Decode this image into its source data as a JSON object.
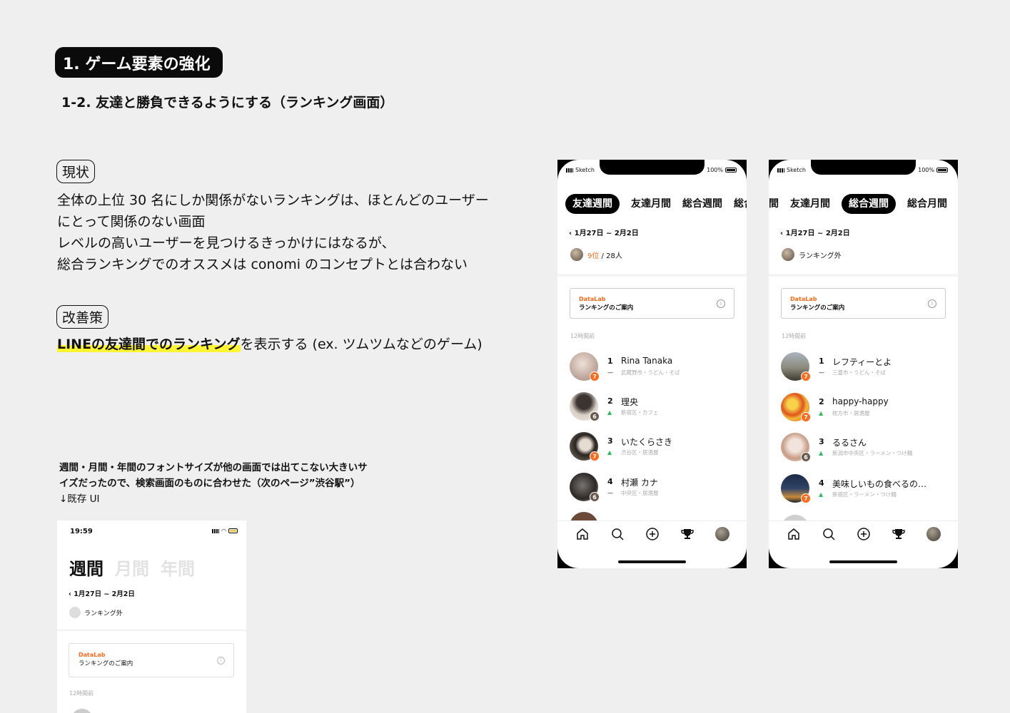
{
  "section": {
    "title": "1. ゲーム要素の強化",
    "subtitle": "1-2. 友達と勝負できるようにする（ランキング画面）"
  },
  "current": {
    "tag": "現状",
    "lines": [
      "全体の上位 30 名にしか関係がないランキングは、ほとんどのユーザー",
      "にとって関係のない画面",
      "レベルの高いユーザーを見つけるきっかけにはなるが、",
      "総合ランキングでのオススメは conomi のコンセプトとは合わない"
    ]
  },
  "improve": {
    "tag": "改善策",
    "highlight": "LINEの友達間でのランキング",
    "rest": "を表示する (ex. ツムツムなどのゲーム)"
  },
  "note": {
    "line1": "週間・月間・年間のフォントサイズが他の画面では出てこない大きいサ",
    "line2": "イズだったので、検索画面のものに合わせた（次のページ”渋谷駅”）",
    "line3": "↓既存 UI"
  },
  "colors": {
    "accent": "#ff6a1a",
    "up": "#2bbf5b",
    "highlight": "#fff533"
  },
  "phone1": {
    "carrier": "Sketch",
    "battery": "100%",
    "tabs": [
      "友達週間",
      "友達月間",
      "総合週間",
      "総合"
    ],
    "active_tab": 0,
    "date": "1月27日 ~ 2月2日",
    "my_rank": "9位",
    "my_total": " / 28人",
    "card_brand": "DataLab",
    "card_title": "ランキングのご案内",
    "card_info": "i",
    "updated": "12時間前",
    "items": [
      {
        "rank": "1",
        "name": "Rina Tanaka",
        "trend": "flat",
        "trend_icon": "—",
        "loc": "武蔵野市・うどん・そば",
        "badge": "7",
        "badge_color": "orange"
      },
      {
        "rank": "2",
        "name": "理央",
        "trend": "up",
        "trend_icon": "▲",
        "loc": "新宿区・カフェ",
        "badge": "6",
        "badge_color": "brown"
      },
      {
        "rank": "3",
        "name": "いたくらさき",
        "trend": "up",
        "trend_icon": "▲",
        "loc": "渋谷区・居酒屋",
        "badge": "7",
        "badge_color": "orange"
      },
      {
        "rank": "4",
        "name": "村瀬 カナ",
        "trend": "flat",
        "trend_icon": "—",
        "loc": "中央区・居酒屋",
        "badge": "6",
        "badge_color": "brown"
      }
    ]
  },
  "phone2": {
    "carrier": "Sketch",
    "battery": "100%",
    "tabs": [
      "間",
      "友達月間",
      "総合週間",
      "総合月間"
    ],
    "active_tab": 2,
    "date": "1月27日 ~ 2月2日",
    "my_status": "ランキング外",
    "card_brand": "DataLab",
    "card_title": "ランキングのご案内",
    "card_info": "i",
    "updated": "12時間前",
    "items": [
      {
        "rank": "1",
        "name": "レフティーとよ",
        "trend": "flat",
        "trend_icon": "—",
        "loc": "三豊市・うどん・そば",
        "badge": "7",
        "badge_color": "orange"
      },
      {
        "rank": "2",
        "name": "happy-happy",
        "trend": "up",
        "trend_icon": "▲",
        "loc": "枚方市・居酒屋",
        "badge": "7",
        "badge_color": "orange"
      },
      {
        "rank": "3",
        "name": "るるさん",
        "trend": "up",
        "trend_icon": "▲",
        "loc": "新潟市中央区・ラーメン・つけ麺",
        "badge": "6",
        "badge_color": "brown"
      },
      {
        "rank": "4",
        "name": "美味しいもの食べるの…",
        "trend": "up",
        "trend_icon": "▲",
        "loc": "新宿区・ラーメン・つけ麺",
        "badge": "7",
        "badge_color": "orange"
      }
    ]
  },
  "existing": {
    "time": "19:59",
    "tabs": [
      "週間",
      "月間",
      "年間"
    ],
    "date": "1月27日 ~ 2月2日",
    "my_status": "ランキング外",
    "card_brand": "DataLab",
    "card_title": "ランキングのご案内",
    "card_info": "i",
    "updated": "12時間前"
  }
}
